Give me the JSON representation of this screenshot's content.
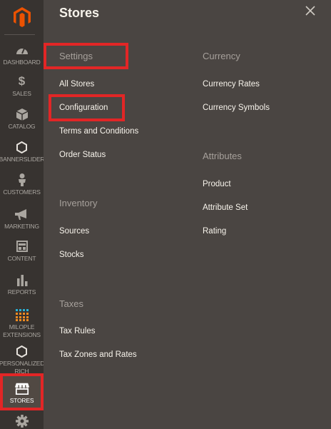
{
  "sidebar": {
    "logo_icon": "magento-logo-icon",
    "accent_color": "#eb5202",
    "items": [
      {
        "label": "DASHBOARD",
        "icon": "speedometer-icon"
      },
      {
        "label": "SALES",
        "icon": "dollar-icon"
      },
      {
        "label": "CATALOG",
        "icon": "cube-icon"
      },
      {
        "label": "BANNERSLIDER",
        "icon": "hexagon-icon"
      },
      {
        "label": "CUSTOMERS",
        "icon": "person-icon"
      },
      {
        "label": "MARKETING",
        "icon": "megaphone-icon"
      },
      {
        "label": "CONTENT",
        "icon": "layout-icon"
      },
      {
        "label": "REPORTS",
        "icon": "bar-chart-icon"
      },
      {
        "label": "MILOPLE EXTENSIONS",
        "label_line1": "MILOPLE",
        "label_line2": "EXTENSIONS",
        "icon": "dot-grid-icon"
      },
      {
        "label": "PERSONALIZED RICH",
        "label_line1": "PERSONALIZED",
        "label_line2": "RICH",
        "icon": "hexagon-icon"
      },
      {
        "label": "STORES",
        "icon": "storefront-icon",
        "active": true
      },
      {
        "label": "",
        "icon": "gear-icon"
      }
    ]
  },
  "panel": {
    "title": "Stores",
    "close_icon": "close-icon",
    "groups": {
      "settings": {
        "title": "Settings",
        "links": [
          "All Stores",
          "Configuration",
          "Terms and Conditions",
          "Order Status"
        ]
      },
      "inventory": {
        "title": "Inventory",
        "links": [
          "Sources",
          "Stocks"
        ]
      },
      "taxes": {
        "title": "Taxes",
        "links": [
          "Tax Rules",
          "Tax Zones and Rates"
        ]
      },
      "currency": {
        "title": "Currency",
        "links": [
          "Currency Rates",
          "Currency Symbols"
        ]
      },
      "attributes": {
        "title": "Attributes",
        "links": [
          "Product",
          "Attribute Set",
          "Rating"
        ]
      }
    }
  },
  "colors": {
    "highlight": "#e22626",
    "panel_bg": "#4a4542",
    "sidebar_bg": "#373330",
    "link_text": "#f7f3eb",
    "group_heading": "#a6a09b"
  }
}
